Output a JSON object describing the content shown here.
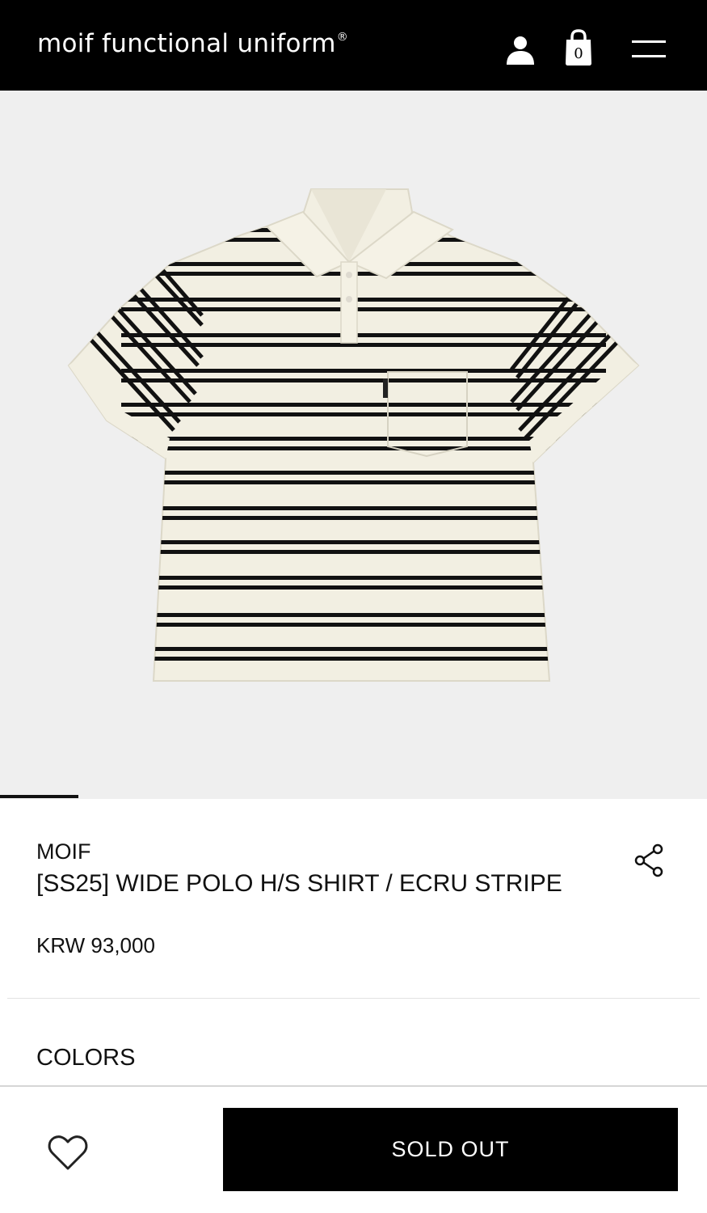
{
  "header": {
    "logo": "moif functional uniform",
    "logo_mark": "®",
    "cart_count": "0",
    "icons": [
      "user-icon",
      "shopping-bag-icon",
      "hamburger-menu-icon"
    ]
  },
  "gallery": {
    "image": "product-photo-striped-polo-shirt",
    "current_slide_progress": 0.11
  },
  "product": {
    "brand": "MOIF",
    "title": "[SS25] WIDE POLO H/S SHIRT / ECRU STRIPE",
    "price": "KRW 93,000",
    "share_icon": "share-icon"
  },
  "options": {
    "colors_label": "COLORS"
  },
  "bottom_bar": {
    "wishlist_icon": "heart-icon",
    "action_label": "SOLD OUT"
  },
  "colors": {
    "header_bg": "#000000",
    "gallery_bg": "#efefef",
    "shirt": "#f2efe2",
    "stripe": "#111111",
    "button_bg": "#000000"
  }
}
